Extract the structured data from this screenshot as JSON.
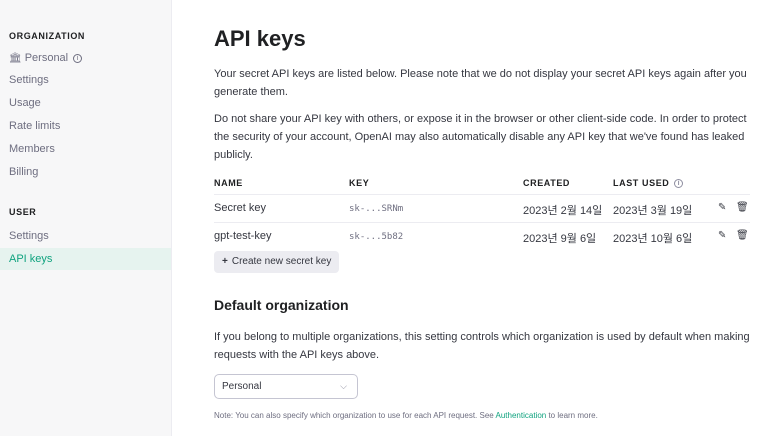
{
  "sidebar": {
    "org_heading": "ORGANIZATION",
    "org_items": [
      {
        "label": "Personal",
        "icon": "building-icon"
      },
      {
        "label": "Settings"
      },
      {
        "label": "Usage"
      },
      {
        "label": "Rate limits"
      },
      {
        "label": "Members"
      },
      {
        "label": "Billing"
      }
    ],
    "user_heading": "USER",
    "user_items": [
      {
        "label": "Settings"
      },
      {
        "label": "API keys",
        "active": true
      }
    ]
  },
  "main": {
    "title": "API keys",
    "intro": "Your secret API keys are listed below. Please note that we do not display your secret API keys again after you generate them.",
    "warning": "Do not share your API key with others, or expose it in the browser or other client-side code. In order to protect the security of your account, OpenAI may also automatically disable any API key that we've found has leaked publicly.",
    "table": {
      "headers": {
        "name": "NAME",
        "key": "KEY",
        "created": "CREATED",
        "last_used": "LAST USED"
      },
      "rows": [
        {
          "name": "Secret key",
          "key": "sk-...SRNm",
          "created": "2023년 2월 14일",
          "last_used": "2023년 3월 19일"
        },
        {
          "name": "gpt-test-key",
          "key": "sk-...5b82",
          "created": "2023년 9월 6일",
          "last_used": "2023년 10월 6일"
        }
      ]
    },
    "create_button": "Create new secret key",
    "default_org": {
      "heading": "Default organization",
      "description": "If you belong to multiple organizations, this setting controls which organization is used by default when making requests with the API keys above.",
      "selected": "Personal",
      "note_prefix": "Note: You can also specify which organization to use for each API request. See ",
      "note_link": "Authentication",
      "note_suffix": " to learn more."
    }
  },
  "colors": {
    "accent": "#10a37f",
    "sidebar_bg": "#f7f7f8",
    "active_bg": "#e6f3ef"
  }
}
